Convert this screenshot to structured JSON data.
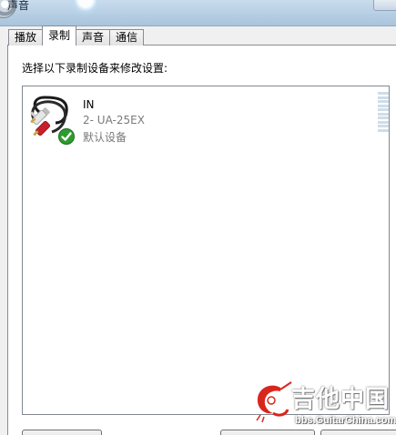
{
  "window": {
    "title": "声音"
  },
  "tabs": [
    {
      "label": "播放",
      "active": false
    },
    {
      "label": "录制",
      "active": true
    },
    {
      "label": "声音",
      "active": false
    },
    {
      "label": "通信",
      "active": false
    }
  ],
  "recording": {
    "instruction": "选择以下录制设备来修改设置:",
    "devices": [
      {
        "name": "IN",
        "description": "2- UA-25EX",
        "status": "默认设备",
        "icon": "rca-cable-icon",
        "status_icon": "default-checkmark-icon"
      }
    ]
  },
  "watermark": {
    "title": "吉他中国",
    "url": "bbs.GuitarChina.com"
  },
  "colors": {
    "check_green": "#2e9b2e",
    "plug_red": "#c8202a",
    "plug_white": "#e6e6e6",
    "meter_idle": "#cfdde8",
    "watermark_red": "#d8261c"
  }
}
